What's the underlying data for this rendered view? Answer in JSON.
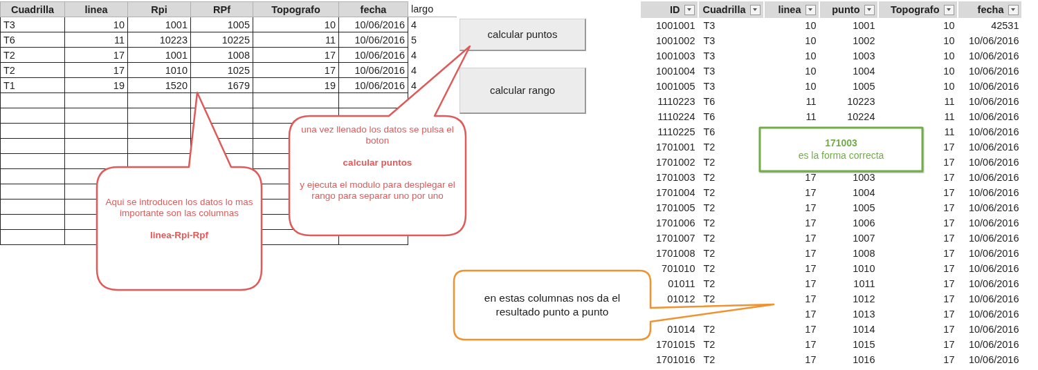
{
  "input_table": {
    "columns": [
      "Cuadrilla",
      "linea",
      "Rpi",
      "RPf",
      "Topografo",
      "fecha",
      "largo"
    ],
    "rows": [
      {
        "cells": [
          "T3",
          "10",
          "1001",
          "1005",
          "10",
          "10/06/2016",
          "4"
        ]
      },
      {
        "cells": [
          "T6",
          "11",
          "10223",
          "10225",
          "11",
          "10/06/2016",
          "5"
        ]
      },
      {
        "cells": [
          "T2",
          "17",
          "1001",
          "1008",
          "17",
          "10/06/2016",
          "4"
        ]
      },
      {
        "cells": [
          "T2",
          "17",
          "1010",
          "1025",
          "17",
          "10/06/2016",
          "4"
        ]
      },
      {
        "cells": [
          "T1",
          "19",
          "1520",
          "1679",
          "19",
          "10/06/2016",
          "4"
        ]
      }
    ]
  },
  "buttons": [
    "calcular puntos",
    "calcular rango"
  ],
  "result_table": {
    "columns": [
      "ID",
      "Cuadrilla",
      "linea",
      "punto",
      "Topografo",
      "fecha"
    ],
    "rows": [
      {
        "id": "1001001",
        "cuadrilla": "T3",
        "linea": "10",
        "punto": "1001",
        "topografo": "10",
        "fecha": "42531"
      },
      {
        "id": "1001002",
        "cuadrilla": "T3",
        "linea": "10",
        "punto": "1002",
        "topografo": "10",
        "fecha": "10/06/2016"
      },
      {
        "id": "1001003",
        "cuadrilla": "T3",
        "linea": "10",
        "punto": "1003",
        "topografo": "10",
        "fecha": "10/06/2016"
      },
      {
        "id": "1001004",
        "cuadrilla": "T3",
        "linea": "10",
        "punto": "1004",
        "topografo": "10",
        "fecha": "10/06/2016"
      },
      {
        "id": "1001005",
        "cuadrilla": "T3",
        "linea": "10",
        "punto": "1005",
        "topografo": "10",
        "fecha": "10/06/2016"
      },
      {
        "id": "1110223",
        "cuadrilla": "T6",
        "linea": "11",
        "punto": "10223",
        "topografo": "11",
        "fecha": "10/06/2016"
      },
      {
        "id": "1110224",
        "cuadrilla": "T6",
        "linea": "11",
        "punto": "10224",
        "topografo": "11",
        "fecha": "10/06/2016"
      },
      {
        "id": "1110225",
        "cuadrilla": "T6",
        "topografo": "11",
        "fecha": "10/06/2016"
      },
      {
        "id": "1701001",
        "cuadrilla": "T2",
        "topografo": "17",
        "fecha": "10/06/2016"
      },
      {
        "id": "1701002",
        "cuadrilla": "T2",
        "topografo": "17",
        "fecha": "10/06/2016"
      },
      {
        "id": "1701003",
        "cuadrilla": "T2",
        "linea": "17",
        "punto": "1003",
        "topografo": "17",
        "fecha": "10/06/2016"
      },
      {
        "id": "1701004",
        "cuadrilla": "T2",
        "linea": "17",
        "punto": "1004",
        "topografo": "17",
        "fecha": "10/06/2016"
      },
      {
        "id": "1701005",
        "cuadrilla": "T2",
        "linea": "17",
        "punto": "1005",
        "topografo": "17",
        "fecha": "10/06/2016"
      },
      {
        "id": "1701006",
        "cuadrilla": "T2",
        "linea": "17",
        "punto": "1006",
        "topografo": "17",
        "fecha": "10/06/2016"
      },
      {
        "id": "1701007",
        "cuadrilla": "T2",
        "linea": "17",
        "punto": "1007",
        "topografo": "17",
        "fecha": "10/06/2016"
      },
      {
        "id": "1701008",
        "cuadrilla": "T2",
        "linea": "17",
        "punto": "1008",
        "topografo": "17",
        "fecha": "10/06/2016"
      },
      {
        "id": "701010",
        "cuadrilla": "T2",
        "linea": "17",
        "punto": "1010",
        "topografo": "17",
        "fecha": "10/06/2016"
      },
      {
        "id": "01011",
        "cuadrilla": "T2",
        "linea": "17",
        "punto": "1011",
        "topografo": "17",
        "fecha": "10/06/2016"
      },
      {
        "id": "01012",
        "cuadrilla": "T2",
        "linea": "17",
        "punto": "1012",
        "topografo": "17",
        "fecha": "10/06/2016"
      },
      {
        "linea": "17",
        "punto": "1013",
        "topografo": "17",
        "fecha": "10/06/2016"
      },
      {
        "id": "01014",
        "cuadrilla": "T2",
        "linea": "17",
        "punto": "1014",
        "topografo": "17",
        "fecha": "10/06/2016"
      },
      {
        "id": "1701015",
        "cuadrilla": "T2",
        "linea": "17",
        "punto": "1015",
        "topografo": "17",
        "fecha": "10/06/2016"
      },
      {
        "id": "1701016",
        "cuadrilla": "T2",
        "linea": "17",
        "punto": "1016",
        "topografo": "17",
        "fecha": "10/06/2016"
      }
    ]
  },
  "callouts": [
    {
      "kind": "speech",
      "color": "#e05a5a",
      "tinted_text": true,
      "paragraphs": [
        {
          "text": "Aqui se introducen los datos lo mas importante son las columnas",
          "bold": false
        },
        {
          "text": "linea-Rpi-Rpf",
          "bold": true
        }
      ]
    },
    {
      "kind": "speech",
      "color": "#e05a5a",
      "tinted_text": true,
      "paragraphs": [
        {
          "text": "una vez llenado los datos se pulsa el boton",
          "bold": false
        },
        {
          "text": "calcular puntos",
          "bold": true
        },
        {
          "text": "y ejecuta el modulo para desplegar el rango para separar  uno por uno",
          "bold": false
        }
      ]
    },
    {
      "kind": "note",
      "color": "#70ad47",
      "tinted_text": true,
      "paragraphs": [
        {
          "text": "171003",
          "bold": true
        },
        {
          "text": "es la forma correcta",
          "bold": false
        }
      ]
    },
    {
      "kind": "speech",
      "color": "#f0922f",
      "tinted_text": false,
      "paragraphs": [
        {
          "text": "en estas columnas nos da el resultado punto a punto",
          "bold": false
        }
      ]
    }
  ]
}
